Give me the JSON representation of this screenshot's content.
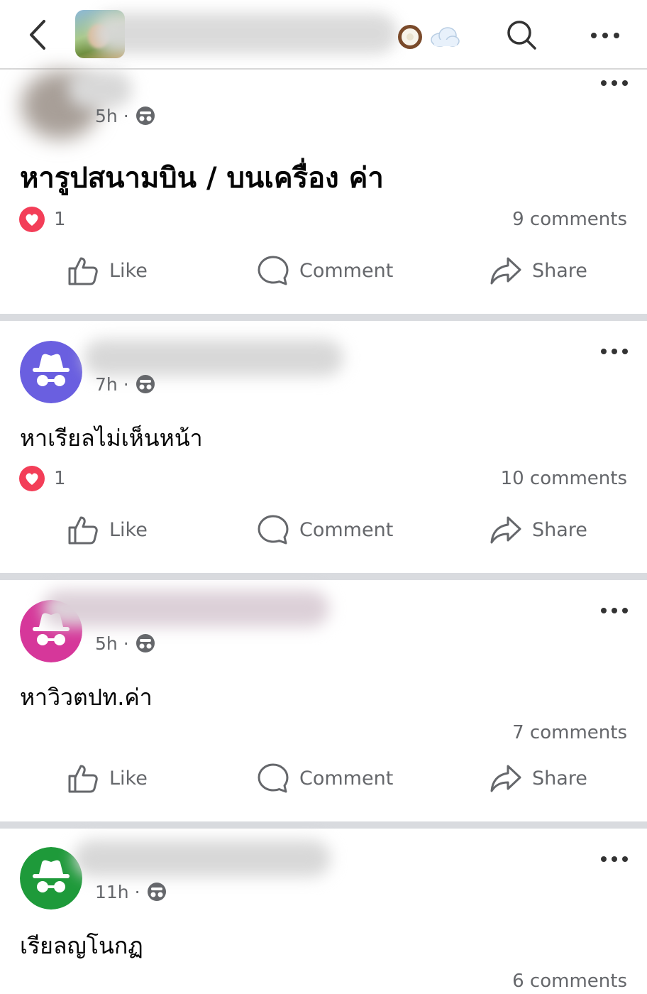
{
  "header": {
    "back_icon": "chevron-left-icon",
    "group_title_emoji_1": "🥥",
    "group_title_emoji_2": "☁️",
    "search_icon": "search-icon",
    "more_icon": "more-horizontal-icon"
  },
  "actions": {
    "like_label": "Like",
    "comment_label": "Comment",
    "share_label": "Share"
  },
  "colors": {
    "reaction_heart": "#f33e58",
    "meta_gray": "#65676b",
    "avatar_purple": "#6a5fe0",
    "avatar_pink": "#d6379a",
    "avatar_green": "#1e9a3a",
    "divider": "#d9dbdf"
  },
  "posts": [
    {
      "time": "5h",
      "text": "หารูปสนามบิน / บนเครื่อง ค่า",
      "reaction_count": "1",
      "comments": "9 comments"
    },
    {
      "time": "7h",
      "text": "หาเรียลไม่เห็นหน้า",
      "reaction_count": "1",
      "comments": "10 comments"
    },
    {
      "time": "5h",
      "text": "หาวิวตปท.ค่า",
      "comments": "7 comments"
    },
    {
      "time": "11h",
      "text": "เรียลญโนกฏ",
      "comments": "6 comments"
    }
  ],
  "meta_separator": "·"
}
